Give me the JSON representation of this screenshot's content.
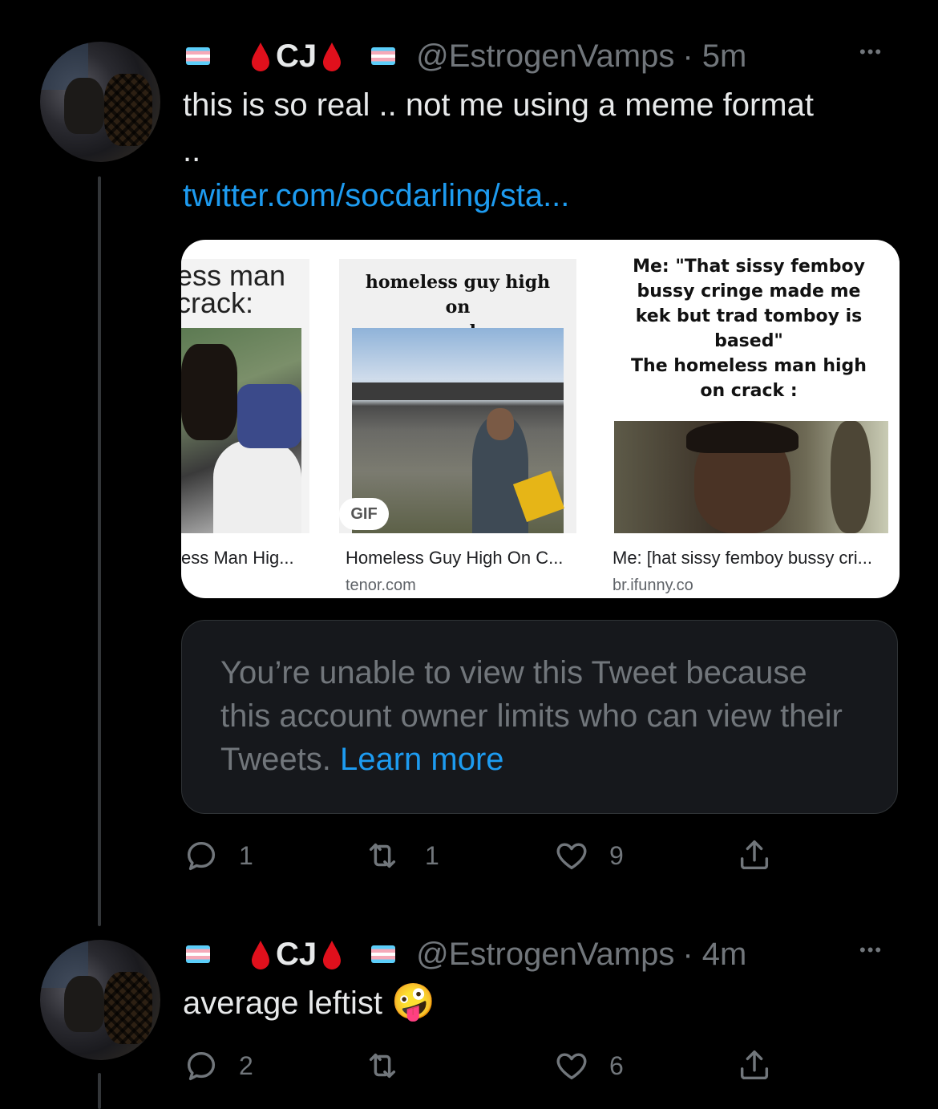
{
  "tweets": [
    {
      "display_name": "CJ",
      "handle": "@EstrogenVamps",
      "time": "· 5m",
      "more": "•••",
      "text_line1": "this is so real .. not me using a meme format",
      "text_line2": "..",
      "link": "twitter.com/socdarling/sta...",
      "image_results": [
        {
          "caption": "ess Man Hig...",
          "source": "",
          "meme_text": "ess man\ncrack:"
        },
        {
          "caption": "Homeless Guy High On C...",
          "source": "tenor.com",
          "meme_text": "homeless guy high on\ncrack:",
          "badge": "GIF"
        },
        {
          "caption": "Me: [hat sissy femboy bussy cri...",
          "source": "br.ifunny.co",
          "meme_text": "Me: \"That sissy femboy bussy cringe made me kek but trad tomboy is based\"\nThe homeless man high on crack :"
        }
      ],
      "unavailable": {
        "text": "You’re unable to view this Tweet because this account owner limits who can view their Tweets.",
        "learn_more": "Learn more"
      },
      "actions": {
        "replies": "1",
        "retweets": "1",
        "likes": "9"
      }
    },
    {
      "display_name": "CJ",
      "handle": "@EstrogenVamps",
      "time": "· 4m",
      "more": "•••",
      "text": "average leftist",
      "emoji": "🤪",
      "actions": {
        "replies": "2",
        "retweets": "",
        "likes": "6"
      }
    }
  ],
  "icons": {
    "flag": "transgender-flag-icon",
    "drop": "blood-drop-icon",
    "reply": "reply-icon",
    "retweet": "retweet-icon",
    "like": "heart-icon",
    "share": "share-icon"
  },
  "colors": {
    "link": "#1d9bf0",
    "muted": "#71767b",
    "drop": "#e0101c"
  }
}
